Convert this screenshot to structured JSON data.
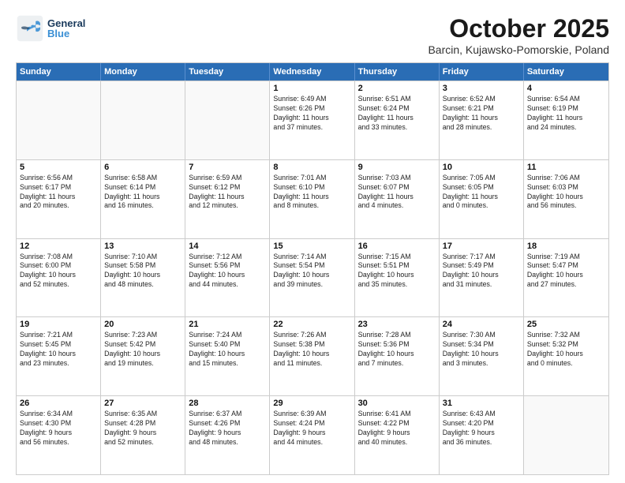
{
  "header": {
    "logo_general": "General",
    "logo_blue": "Blue",
    "month_title": "October 2025",
    "location": "Barcin, Kujawsko-Pomorskie, Poland"
  },
  "days_of_week": [
    "Sunday",
    "Monday",
    "Tuesday",
    "Wednesday",
    "Thursday",
    "Friday",
    "Saturday"
  ],
  "weeks": [
    [
      {
        "day": "",
        "info": ""
      },
      {
        "day": "",
        "info": ""
      },
      {
        "day": "",
        "info": ""
      },
      {
        "day": "1",
        "info": "Sunrise: 6:49 AM\nSunset: 6:26 PM\nDaylight: 11 hours\nand 37 minutes."
      },
      {
        "day": "2",
        "info": "Sunrise: 6:51 AM\nSunset: 6:24 PM\nDaylight: 11 hours\nand 33 minutes."
      },
      {
        "day": "3",
        "info": "Sunrise: 6:52 AM\nSunset: 6:21 PM\nDaylight: 11 hours\nand 28 minutes."
      },
      {
        "day": "4",
        "info": "Sunrise: 6:54 AM\nSunset: 6:19 PM\nDaylight: 11 hours\nand 24 minutes."
      }
    ],
    [
      {
        "day": "5",
        "info": "Sunrise: 6:56 AM\nSunset: 6:17 PM\nDaylight: 11 hours\nand 20 minutes."
      },
      {
        "day": "6",
        "info": "Sunrise: 6:58 AM\nSunset: 6:14 PM\nDaylight: 11 hours\nand 16 minutes."
      },
      {
        "day": "7",
        "info": "Sunrise: 6:59 AM\nSunset: 6:12 PM\nDaylight: 11 hours\nand 12 minutes."
      },
      {
        "day": "8",
        "info": "Sunrise: 7:01 AM\nSunset: 6:10 PM\nDaylight: 11 hours\nand 8 minutes."
      },
      {
        "day": "9",
        "info": "Sunrise: 7:03 AM\nSunset: 6:07 PM\nDaylight: 11 hours\nand 4 minutes."
      },
      {
        "day": "10",
        "info": "Sunrise: 7:05 AM\nSunset: 6:05 PM\nDaylight: 11 hours\nand 0 minutes."
      },
      {
        "day": "11",
        "info": "Sunrise: 7:06 AM\nSunset: 6:03 PM\nDaylight: 10 hours\nand 56 minutes."
      }
    ],
    [
      {
        "day": "12",
        "info": "Sunrise: 7:08 AM\nSunset: 6:00 PM\nDaylight: 10 hours\nand 52 minutes."
      },
      {
        "day": "13",
        "info": "Sunrise: 7:10 AM\nSunset: 5:58 PM\nDaylight: 10 hours\nand 48 minutes."
      },
      {
        "day": "14",
        "info": "Sunrise: 7:12 AM\nSunset: 5:56 PM\nDaylight: 10 hours\nand 44 minutes."
      },
      {
        "day": "15",
        "info": "Sunrise: 7:14 AM\nSunset: 5:54 PM\nDaylight: 10 hours\nand 39 minutes."
      },
      {
        "day": "16",
        "info": "Sunrise: 7:15 AM\nSunset: 5:51 PM\nDaylight: 10 hours\nand 35 minutes."
      },
      {
        "day": "17",
        "info": "Sunrise: 7:17 AM\nSunset: 5:49 PM\nDaylight: 10 hours\nand 31 minutes."
      },
      {
        "day": "18",
        "info": "Sunrise: 7:19 AM\nSunset: 5:47 PM\nDaylight: 10 hours\nand 27 minutes."
      }
    ],
    [
      {
        "day": "19",
        "info": "Sunrise: 7:21 AM\nSunset: 5:45 PM\nDaylight: 10 hours\nand 23 minutes."
      },
      {
        "day": "20",
        "info": "Sunrise: 7:23 AM\nSunset: 5:42 PM\nDaylight: 10 hours\nand 19 minutes."
      },
      {
        "day": "21",
        "info": "Sunrise: 7:24 AM\nSunset: 5:40 PM\nDaylight: 10 hours\nand 15 minutes."
      },
      {
        "day": "22",
        "info": "Sunrise: 7:26 AM\nSunset: 5:38 PM\nDaylight: 10 hours\nand 11 minutes."
      },
      {
        "day": "23",
        "info": "Sunrise: 7:28 AM\nSunset: 5:36 PM\nDaylight: 10 hours\nand 7 minutes."
      },
      {
        "day": "24",
        "info": "Sunrise: 7:30 AM\nSunset: 5:34 PM\nDaylight: 10 hours\nand 3 minutes."
      },
      {
        "day": "25",
        "info": "Sunrise: 7:32 AM\nSunset: 5:32 PM\nDaylight: 10 hours\nand 0 minutes."
      }
    ],
    [
      {
        "day": "26",
        "info": "Sunrise: 6:34 AM\nSunset: 4:30 PM\nDaylight: 9 hours\nand 56 minutes."
      },
      {
        "day": "27",
        "info": "Sunrise: 6:35 AM\nSunset: 4:28 PM\nDaylight: 9 hours\nand 52 minutes."
      },
      {
        "day": "28",
        "info": "Sunrise: 6:37 AM\nSunset: 4:26 PM\nDaylight: 9 hours\nand 48 minutes."
      },
      {
        "day": "29",
        "info": "Sunrise: 6:39 AM\nSunset: 4:24 PM\nDaylight: 9 hours\nand 44 minutes."
      },
      {
        "day": "30",
        "info": "Sunrise: 6:41 AM\nSunset: 4:22 PM\nDaylight: 9 hours\nand 40 minutes."
      },
      {
        "day": "31",
        "info": "Sunrise: 6:43 AM\nSunset: 4:20 PM\nDaylight: 9 hours\nand 36 minutes."
      },
      {
        "day": "",
        "info": ""
      }
    ]
  ]
}
